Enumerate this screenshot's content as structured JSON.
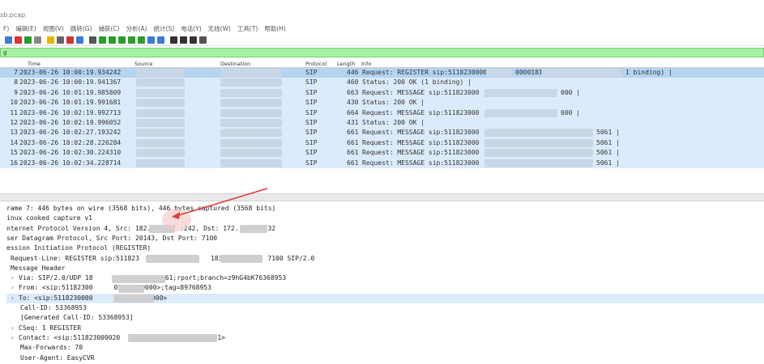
{
  "window": {
    "title": "sb.pcap"
  },
  "menu": [
    "F)",
    "编辑(E)",
    "视图(V)",
    "跳转(G)",
    "捕获(C)",
    "分析(A)",
    "统计(S)",
    "电话(Y)",
    "无线(W)",
    "工具(T)",
    "帮助(H)"
  ],
  "toolbar": [
    "shark-fin-icon",
    "stop-icon",
    "restart-icon",
    "options-icon",
    "open-icon",
    "save-icon",
    "close-file-icon",
    "reload-icon",
    "find-icon",
    "back-icon",
    "forward-icon",
    "goto-icon",
    "first-icon",
    "last-icon",
    "autoscroll-icon",
    "colorize-icon",
    "zoom-in-icon",
    "zoom-out-icon",
    "zoom-reset-icon",
    "resize-columns-icon"
  ],
  "filter": {
    "text": "ɡ"
  },
  "columns": {
    "time": "Time",
    "source": "Source",
    "destination": "Destination",
    "protocol": "Protocol",
    "length": "Length",
    "info": "Info"
  },
  "packets": [
    {
      "no": "7",
      "time": "2023-06-26 10:00:19.934242",
      "protocol": "SIP",
      "length": "446",
      "info_a": "Request: REGISTER sip:5118230000",
      "info_b": "0000181",
      "info_c": "1 binding) |"
    },
    {
      "no": "8",
      "time": "2023-06-26 10:00:19.941367",
      "protocol": "SIP",
      "length": "460",
      "info_a": "Status: 200 OK  (1 binding) |",
      "info_b": "",
      "info_c": ""
    },
    {
      "no": "9",
      "time": "2023-06-26 10:01:19.985809",
      "protocol": "SIP",
      "length": "663",
      "info_a": "Request: MESSAGE sip:511823000",
      "info_b": "",
      "info_c": "000 |"
    },
    {
      "no": "10",
      "time": "2023-06-26 10:01:19.991681",
      "protocol": "SIP",
      "length": "430",
      "info_a": "Status: 200 OK |",
      "info_b": "",
      "info_c": ""
    },
    {
      "no": "11",
      "time": "2023-06-26 10:02:19.992713",
      "protocol": "SIP",
      "length": "664",
      "info_a": "Request: MESSAGE sip:511823000",
      "info_b": "",
      "info_c": "000 |"
    },
    {
      "no": "12",
      "time": "2023-06-26 10:02:19.996052",
      "protocol": "SIP",
      "length": "431",
      "info_a": "Status: 200 OK |",
      "info_b": "",
      "info_c": ""
    },
    {
      "no": "13",
      "time": "2023-06-26 10:02:27.193242",
      "protocol": "SIP",
      "length": "661",
      "info_a": "Request: MESSAGE sip:511823000",
      "info_b": "",
      "info_c": "5061 |"
    },
    {
      "no": "14",
      "time": "2023-06-26 10:02:28.226284",
      "protocol": "SIP",
      "length": "661",
      "info_a": "Request: MESSAGE sip:511823000",
      "info_b": "",
      "info_c": "5061 |"
    },
    {
      "no": "15",
      "time": "2023-06-26 10:02:30.224310",
      "protocol": "SIP",
      "length": "661",
      "info_a": "Request: MESSAGE sip:511823000",
      "info_b": "",
      "info_c": "5061 |"
    },
    {
      "no": "16",
      "time": "2023-06-26 10:02:34.228714",
      "protocol": "SIP",
      "length": "661",
      "info_a": "Request: MESSAGE sip:511823000",
      "info_b": "",
      "info_c": "5061 |"
    }
  ],
  "details": {
    "frame": "rame 7: 446 bytes on wire (3568 bits), 446 bytes captured (3568 bits)",
    "linux": "inux cooked capture v1",
    "ip_a": "nternet Protocol Version 4, Src: 182.",
    "ip_b": ".242, Dst: 172.",
    "ip_c": "32",
    "udp": "ser Datagram Protocol, Src Port: 20143, Dst Port: 7100",
    "sip": "ession Initiation Protocol (REGISTER)",
    "request_line_a": "Request-Line: REGISTER sip:511823",
    "request_line_b": "183",
    "request_line_c": "7100 SIP/2.0",
    "message_header": "Message Header",
    "via_a": "Via: SIP/2.0/UDP 18",
    "via_b": "2:5061;rport;branch=z9hG4bK76368953",
    "from_a": "From: <sip:51182300",
    "from_b": "05118230000>;tag=89768953",
    "to_a": "To: <sip:5118230000",
    "to_b": "230000>",
    "call_id": "Call-ID: 53368953",
    "gen_call_id": "[Generated Call-ID: 53368953]",
    "cseq": "CSeq: 1 REGISTER",
    "contact_a": "Contact: <sip:511823000020",
    "contact_b": "2:5061>",
    "max_forwards": "Max-Forwards: 70",
    "user_agent": "User-Agent: EasyCVR"
  }
}
